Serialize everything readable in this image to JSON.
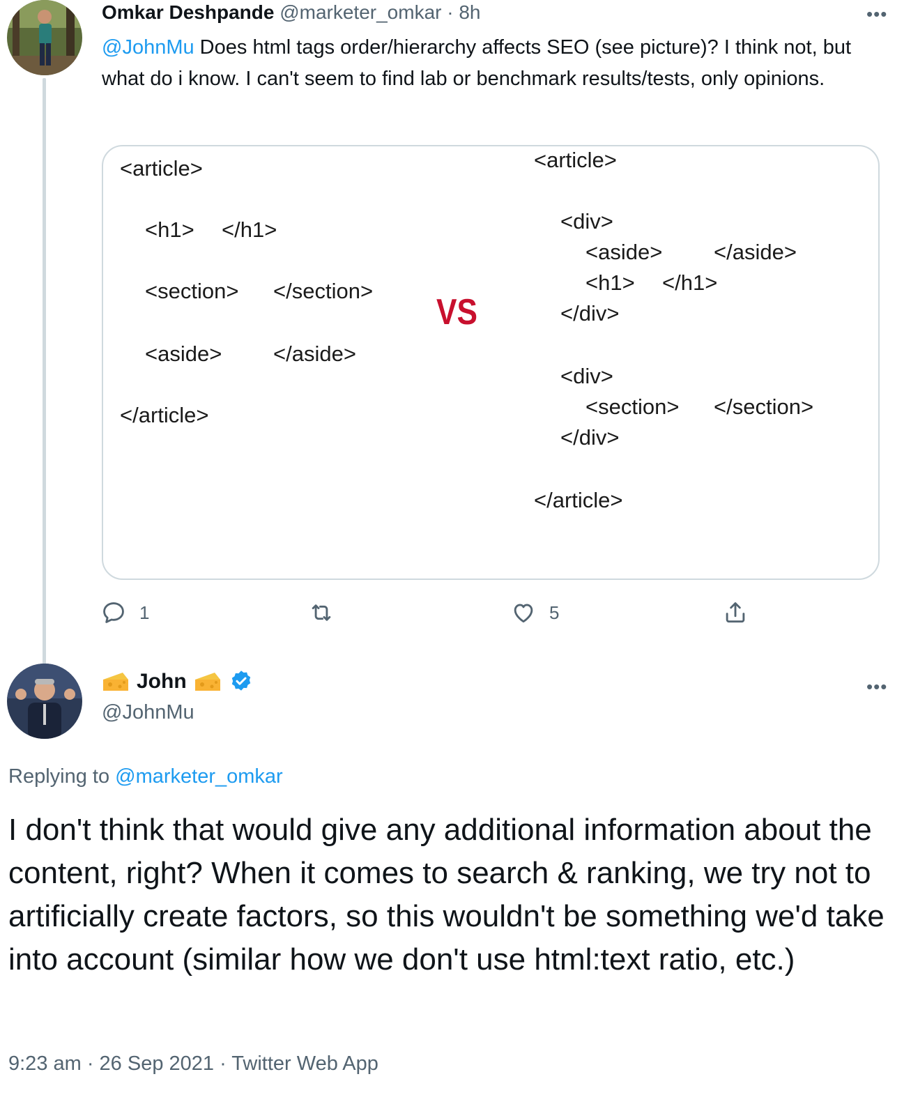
{
  "original_tweet": {
    "author_name": "Omkar Deshpande",
    "author_handle": "@marketer_omkar",
    "separator": "·",
    "time_ago": "8h",
    "mention": "@JohnMu",
    "text": " Does html tags order/hierarchy affects SEO (see picture)? I think not, but what do i know. I can't seem to find lab or benchmark results/tests, only opinions.",
    "media": {
      "left_code": [
        "<article>",
        "<h1>",
        "</h1>",
        "<section>",
        "</section>",
        "<aside>",
        "</aside>",
        "</article>"
      ],
      "vs_label": "VS",
      "right_code": [
        "<article>",
        "<div>",
        "<aside>",
        "</aside>",
        "<h1>",
        "</h1>",
        "</div>",
        "<div>",
        "<section>",
        "</section>",
        "</div>",
        "</article>"
      ]
    },
    "actions": {
      "reply_count": "1",
      "retweet_count": "",
      "like_count": "5"
    }
  },
  "reply_tweet": {
    "author_name": "John",
    "author_handle": "@JohnMu",
    "verified": true,
    "replying_prefix": "Replying to ",
    "replying_handle": "@marketer_omkar",
    "text": "I don't think that would give any additional information about the content, right? When it comes to search & ranking, we try not to artificially create factors, so this wouldn't be something we'd take into account (similar how we don't use html:text ratio, etc.)",
    "timestamp": "9:23 am · 26 Sep 2021 · Twitter Web App"
  },
  "colors": {
    "link": "#1d9bf0",
    "muted": "#536471",
    "vs": "#c8102e"
  },
  "icons": [
    "reply-icon",
    "retweet-icon",
    "like-icon",
    "share-icon",
    "more-icon",
    "verified-badge-icon",
    "cheese-emoji"
  ]
}
